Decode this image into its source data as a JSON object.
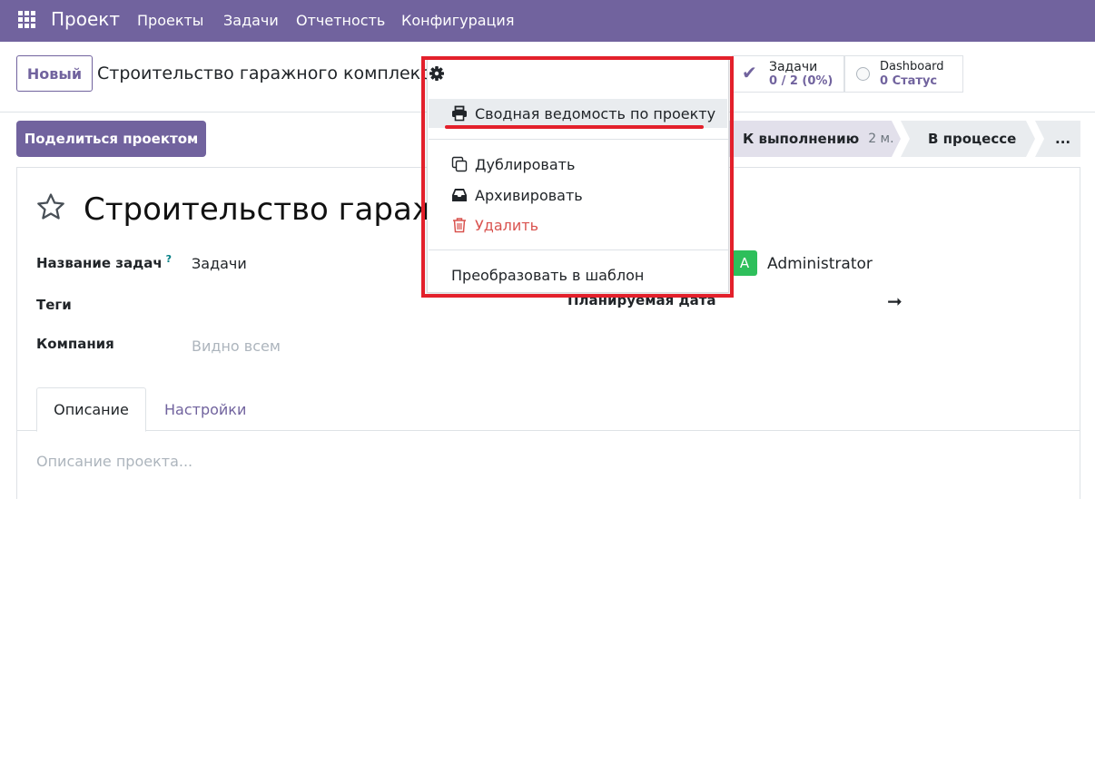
{
  "topnav": {
    "brand": "Проект",
    "menu": [
      "Проекты",
      "Задачи",
      "Отчетность",
      "Конфигурация"
    ]
  },
  "control": {
    "new_label": "Новый",
    "breadcrumb_title": "Строительство гаражного комплекса",
    "stat_tasks": {
      "title": "Задачи",
      "value": "0 / 2 (0%)"
    },
    "stat_dashboard": {
      "title": "Dashboard",
      "value": "0 Статус"
    }
  },
  "actions": {
    "share_label": "Поделиться проектом",
    "stages": [
      {
        "label": "К выполнению",
        "count": "2 м."
      },
      {
        "label": "В процессе"
      },
      {
        "label": "..."
      }
    ]
  },
  "form": {
    "title": "Строительство гаражного комплекса",
    "fields": {
      "task_name_label": "Название задач",
      "task_name_help": "?",
      "task_name_value": "Задачи",
      "tags_label": "Теги",
      "company_label": "Компания",
      "company_placeholder": "Видно всем",
      "planned_label": "Планируемая дата",
      "manager_avatar": "A",
      "manager_name": "Administrator"
    },
    "tabs": [
      "Описание",
      "Настройки"
    ],
    "description_placeholder": "Описание проекта..."
  },
  "dropdown": {
    "items": [
      "Сводная ведомость по проекту",
      "Дублировать",
      "Архивировать",
      "Удалить",
      "Преобразовать в шаблон"
    ]
  },
  "colors": {
    "brand": "#71639e",
    "highlight": "#e3202b",
    "avatar": "#2ebf5b",
    "danger": "#d9534f"
  }
}
